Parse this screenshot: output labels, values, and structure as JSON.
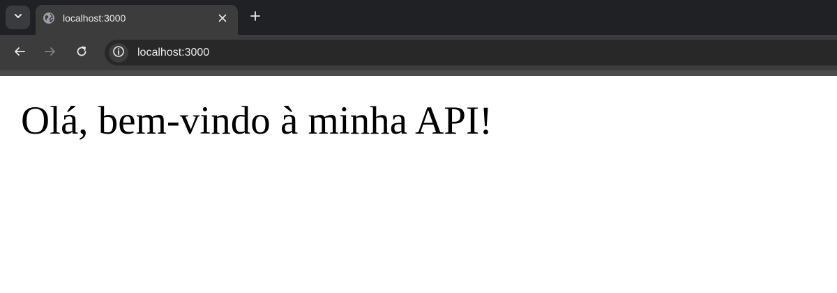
{
  "browser": {
    "tab": {
      "title": "localhost:3000"
    },
    "address_bar": {
      "url": "localhost:3000"
    },
    "icons": {
      "tab_search": "chevron-down-icon",
      "favicon": "globe-icon",
      "close": "close-icon",
      "new_tab": "plus-icon",
      "back": "arrow-left-icon",
      "forward": "arrow-right-icon",
      "reload": "reload-icon",
      "site_info": "info-icon"
    }
  },
  "page": {
    "heading": "Olá, bem-vindo à minha API!"
  },
  "colors": {
    "tabstrip_bg": "#202124",
    "toolbar_bg": "#3c3c3c",
    "omnibox_bg": "#282828",
    "page_bg": "#ffffff",
    "text_light": "#e8eaed"
  }
}
